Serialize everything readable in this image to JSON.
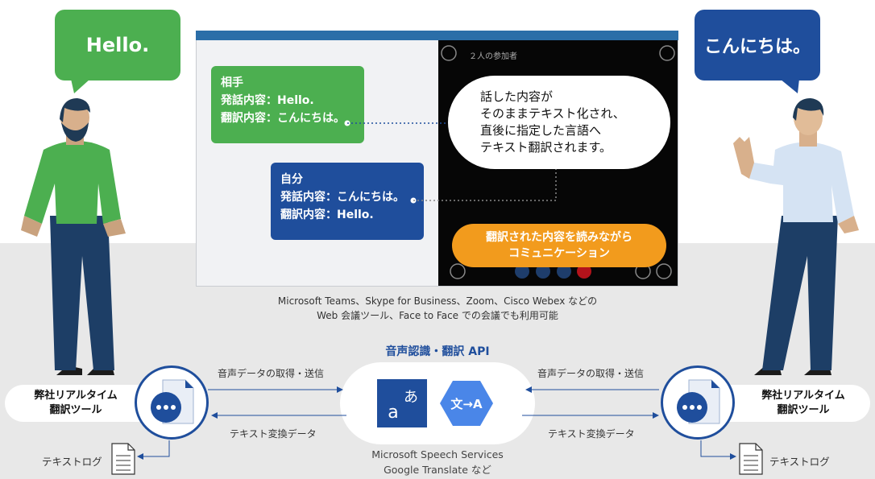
{
  "left_person": {
    "speech": "Hello."
  },
  "right_person": {
    "speech": "こんにちは。"
  },
  "meeting_screen": {
    "participants": "２人の参加者",
    "other_card": {
      "title": "相手",
      "spoken": "発話内容：Hello.",
      "translated": "翻訳内容：こんにちは。"
    },
    "self_card": {
      "title": "自分",
      "spoken": "発話内容：こんにちは。",
      "translated": "翻訳内容：Hello."
    },
    "explanation": [
      "話した内容が",
      "そのままテキスト化され、",
      "直後に指定した言語へ",
      "テキスト翻訳されます。"
    ],
    "callout": [
      "翻訳された内容を読みながら",
      "コミュニケーション"
    ]
  },
  "caption": [
    "Microsoft Teams、Skype for Business、Zoom、Cisco Webex などの",
    "Web 会議ツール、Face to Face での会議でも利用可能"
  ],
  "api": {
    "title": "音声認識・翻訳 API",
    "providers": [
      "Microsoft Speech Services",
      "Google Translate など"
    ],
    "icons": [
      "ms-translator-icon",
      "google-translate-icon"
    ],
    "ms_glyphs": [
      "あ",
      "a"
    ],
    "google_glyph": "文→A"
  },
  "left_tool": {
    "label": [
      "弊社リアルタイム",
      "翻訳ツール"
    ],
    "log": "テキストログ"
  },
  "right_tool": {
    "label": [
      "弊社リアルタイム",
      "翻訳ツール"
    ],
    "log": "テキストログ"
  },
  "flows": {
    "left_send": "音声データの取得・送信",
    "left_receive": "テキスト変換データ",
    "right_send": "音声データの取得・送信",
    "right_receive": "テキスト変換データ"
  },
  "colors": {
    "green": "#4caf50",
    "blue": "#1f4e9c",
    "orange": "#f29b1d",
    "dark": "#060606"
  }
}
